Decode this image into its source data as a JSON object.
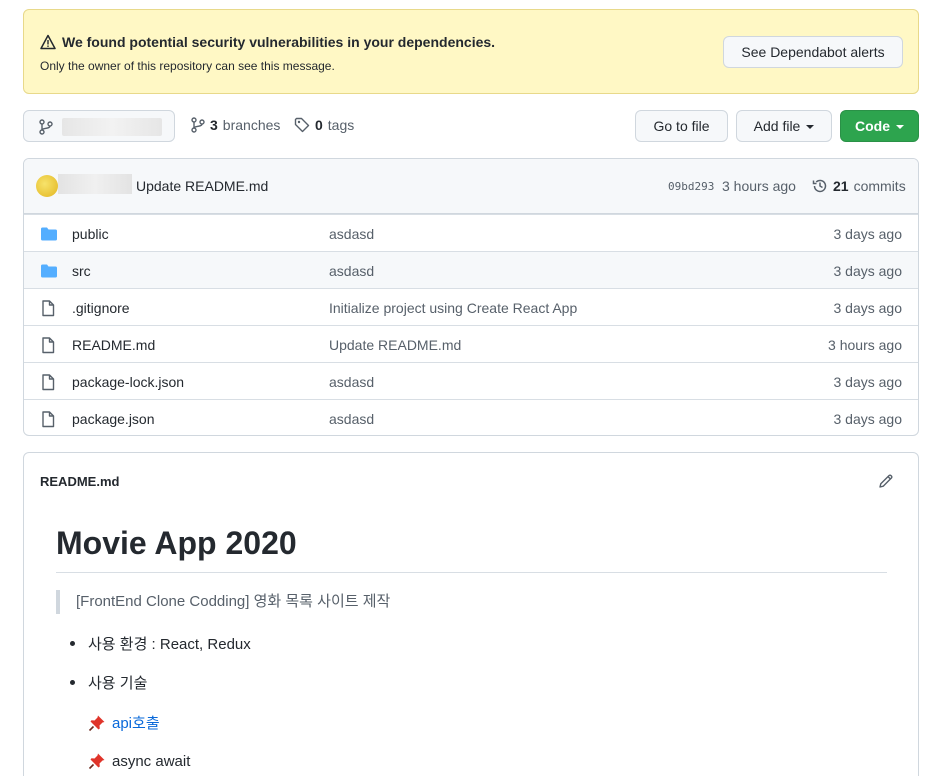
{
  "alert": {
    "title": "We found potential security vulnerabilities in your dependencies.",
    "subtitle": "Only the owner of this repository can see this message.",
    "button": "See Dependabot alerts"
  },
  "repo_nav": {
    "branches_count": "3",
    "branches_label": "branches",
    "tags_count": "0",
    "tags_label": "tags",
    "go_to_file": "Go to file",
    "add_file": "Add file",
    "code": "Code"
  },
  "latest_commit": {
    "message": "Update README.md",
    "sha": "09bd293",
    "time": "3 hours ago",
    "commits_count": "21",
    "commits_label": "commits"
  },
  "files": [
    {
      "type": "folder",
      "name": "public",
      "message": "asdasd",
      "age": "3 days ago"
    },
    {
      "type": "folder",
      "name": "src",
      "message": "asdasd",
      "age": "3 days ago"
    },
    {
      "type": "file",
      "name": ".gitignore",
      "message": "Initialize project using Create React App",
      "age": "3 days ago"
    },
    {
      "type": "file",
      "name": "README.md",
      "message": "Update README.md",
      "age": "3 hours ago"
    },
    {
      "type": "file",
      "name": "package-lock.json",
      "message": "asdasd",
      "age": "3 days ago"
    },
    {
      "type": "file",
      "name": "package.json",
      "message": "asdasd",
      "age": "3 days ago"
    }
  ],
  "readme": {
    "filename": "README.md",
    "title": "Movie App 2020",
    "quote": "[FrontEnd Clone Codding] 영화 목록 사이트 제작",
    "items": [
      "사용 환경 : React, Redux",
      "사용 기술"
    ],
    "sub_items": [
      {
        "text": "api호출",
        "link": true
      },
      {
        "text": "async await",
        "link": false
      }
    ]
  },
  "colors": {
    "alert_bg": "#fff8c5",
    "code_button": "#2da44e",
    "folder": "#54aeff",
    "link": "#0969da"
  }
}
